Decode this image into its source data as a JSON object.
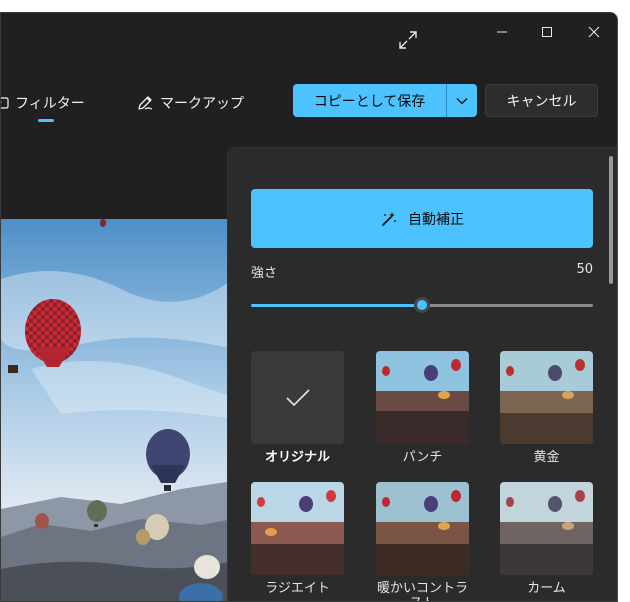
{
  "window": {
    "controls": {
      "minimize": "—",
      "maximize": "☐",
      "close": "✕"
    }
  },
  "toolbar": {
    "filter_tab": "フィルター",
    "markup_tab": "マークアップ",
    "save_label": "コピーとして保存",
    "cancel_label": "キャンセル"
  },
  "panel": {
    "auto_enhance_label": "自動補正",
    "strength_label": "強さ",
    "strength_value": "50",
    "strength_fraction": 0.5,
    "filters": [
      {
        "label": "オリジナル",
        "selected": true
      },
      {
        "label": "パンチ"
      },
      {
        "label": "黄金"
      },
      {
        "label": "ラジエイト"
      },
      {
        "label": "暖かいコントラスト"
      },
      {
        "label": "カーム"
      }
    ]
  },
  "colors": {
    "accent": "#4cc2ff",
    "background": "#202020",
    "panel": "#2b2b2b"
  }
}
